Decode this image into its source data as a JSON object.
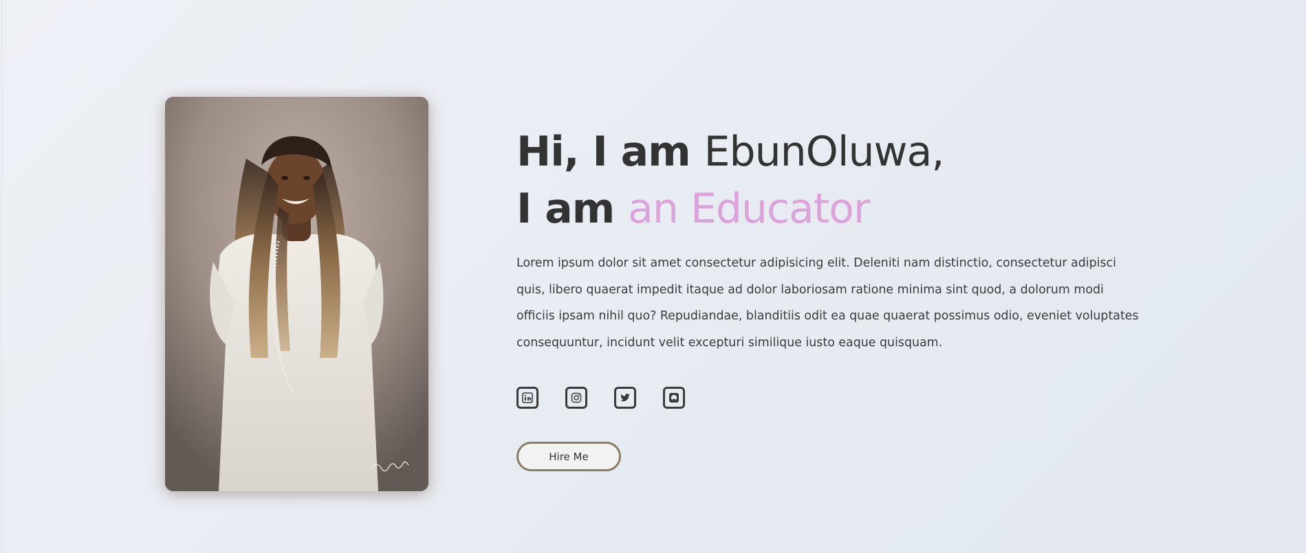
{
  "hero": {
    "greeting_bold": "Hi, I am",
    "name": "EbunOluwa,",
    "role_prefix": "I am",
    "role": "an Educator",
    "bio": "Lorem ipsum dolor sit amet consectetur adipisicing elit. Deleniti nam distinctio, consectetur adipisci quis, libero quaerat impedit itaque ad dolor laboriosam ratione minima sint quod, a dolorum modi officiis ipsam nihil quo? Repudiandae, blanditiis odit ea quae quaerat possimus odio, eveniet voluptates consequuntur, incidunt velit excepturi similique iusto eaque quisquam.",
    "hire_button": "Hire Me"
  },
  "socials": [
    {
      "icon": "linkedin-icon"
    },
    {
      "icon": "instagram-icon"
    },
    {
      "icon": "twitter-icon"
    },
    {
      "icon": "github-icon"
    }
  ],
  "colors": {
    "text": "#333333",
    "accent": "#dda2da",
    "button_border": "#8a7c66"
  }
}
